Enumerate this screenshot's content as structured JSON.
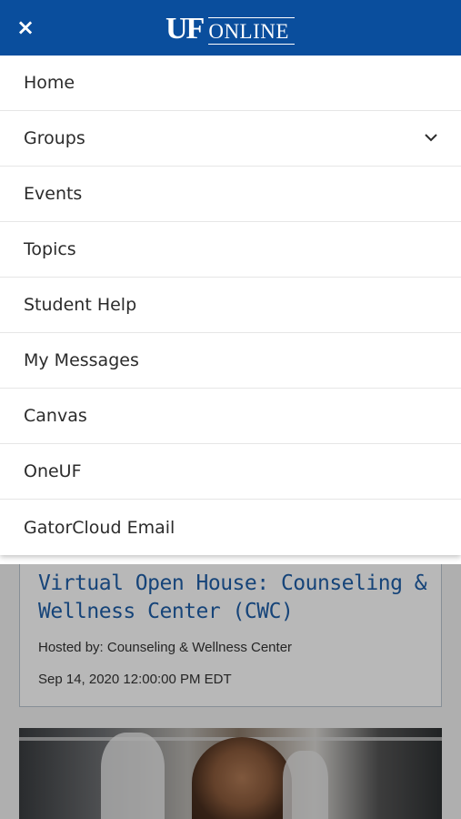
{
  "header": {
    "close_symbol": "×",
    "logo_uf": "UF",
    "logo_online": "ONLINE",
    "background_color": "#0a4e9d"
  },
  "menu": {
    "items": [
      {
        "label": "Home"
      },
      {
        "label": "Groups",
        "expandable": true,
        "icon": "chevron-down-icon"
      },
      {
        "label": "Events"
      },
      {
        "label": "Topics"
      },
      {
        "label": "Student Help"
      },
      {
        "label": "My Messages"
      },
      {
        "label": "Canvas"
      },
      {
        "label": "OneUF"
      },
      {
        "label": "GatorCloud Email"
      }
    ]
  },
  "event_card": {
    "title": "Virtual Open House: Counseling & Wellness Center (CWC)",
    "hosted_by": "Hosted by: Counseling & Wellness Center",
    "date": "Sep 14, 2020 12:00:00 PM EDT",
    "title_color": "#1f5fa8"
  }
}
